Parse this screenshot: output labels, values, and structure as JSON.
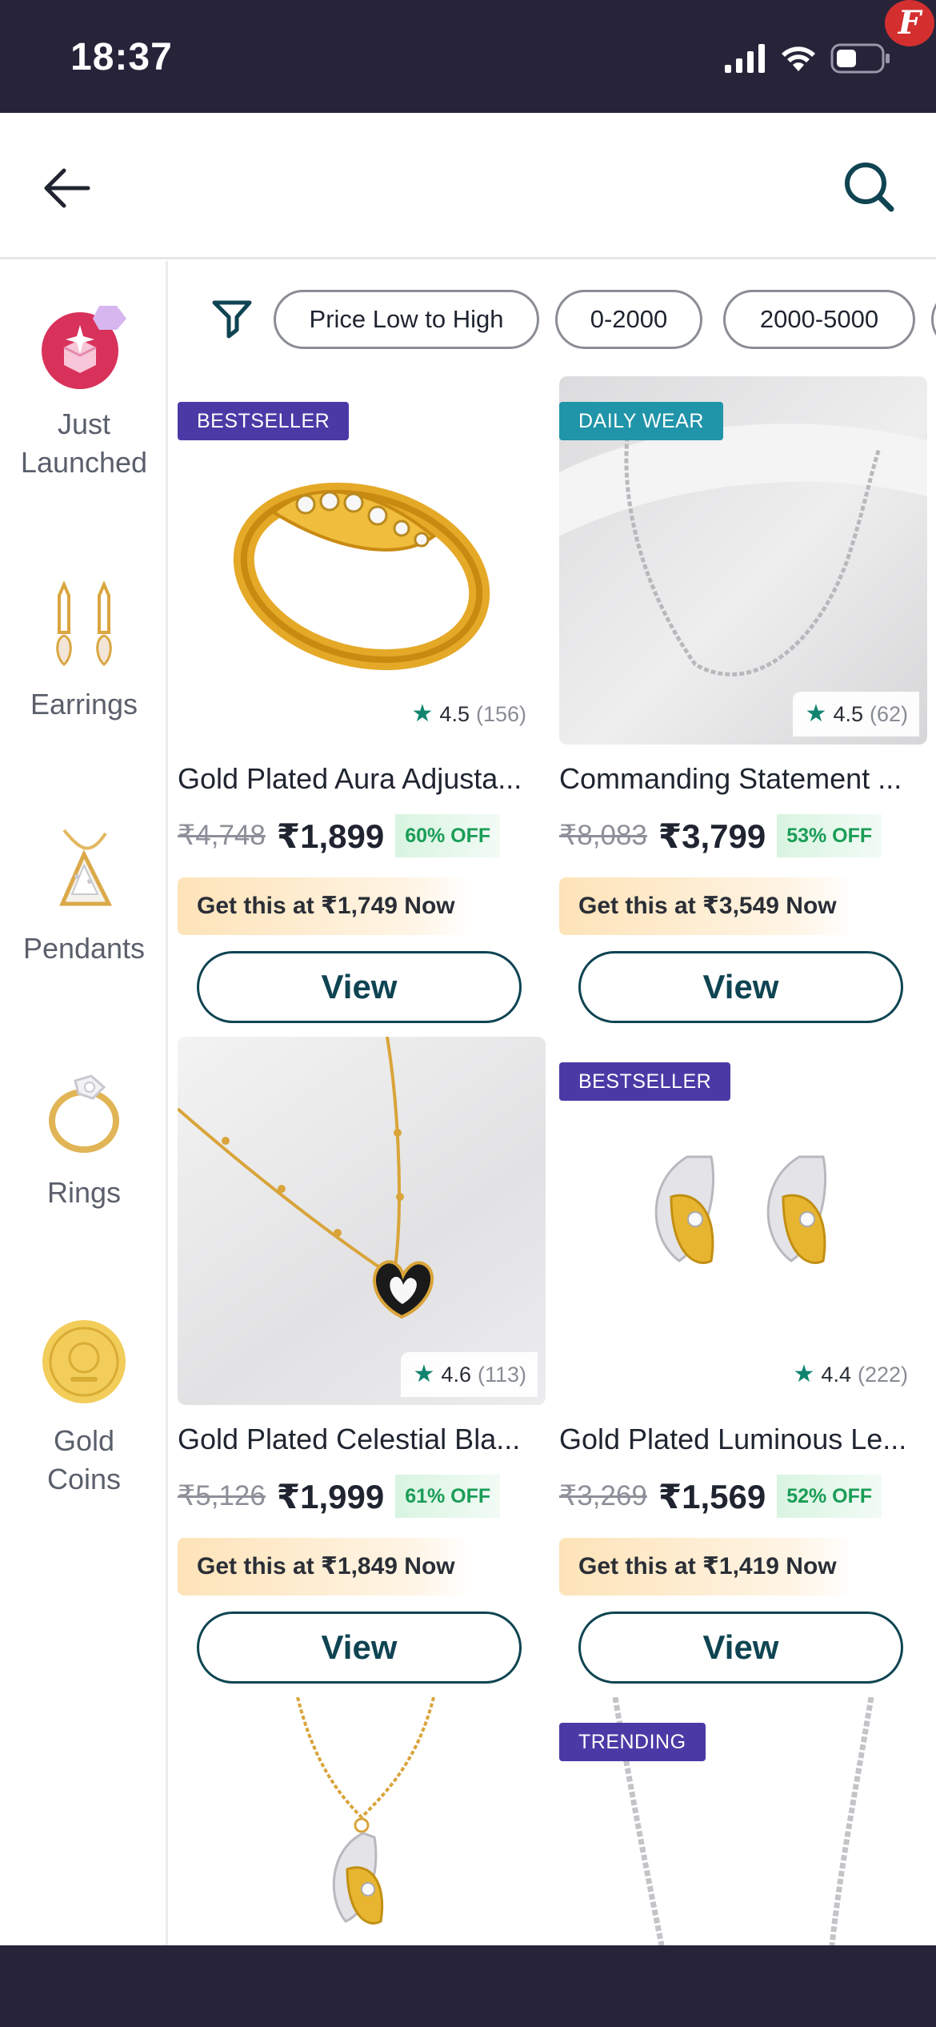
{
  "status_bar": {
    "time": "18:37",
    "app_badge": "F"
  },
  "header": {
    "back_icon": "arrow-left-icon",
    "search_icon": "search-icon"
  },
  "sidebar": {
    "items": [
      {
        "label": "Just Launched",
        "icon": "sparkle-gift-icon"
      },
      {
        "label": "Earrings",
        "icon": "earrings-icon"
      },
      {
        "label": "Pendants",
        "icon": "pendant-icon"
      },
      {
        "label": "Rings",
        "icon": "ring-icon"
      },
      {
        "label": "Gold Coins",
        "icon": "gold-coin-icon"
      }
    ]
  },
  "filters": {
    "icon": "filter-funnel-icon",
    "chips": [
      "Price Low to High",
      "0-2000",
      "2000-5000"
    ]
  },
  "products": [
    {
      "tag": "BESTSELLER",
      "rating": "4.5",
      "rating_count": "(156)",
      "title": "Gold Plated Aura Adjusta...",
      "mrp": "₹4,748",
      "price": "₹1,899",
      "discount": "60% OFF",
      "offer": "Get this at ₹1,749 Now",
      "cta": "View"
    },
    {
      "tag": "DAILY WEAR",
      "rating": "4.5",
      "rating_count": "(62)",
      "title": "Commanding Statement ...",
      "mrp": "₹8,083",
      "price": "₹3,799",
      "discount": "53% OFF",
      "offer": "Get this at ₹3,549 Now",
      "cta": "View"
    },
    {
      "tag": "",
      "rating": "4.6",
      "rating_count": "(113)",
      "title": "Gold Plated Celestial Bla...",
      "mrp": "₹5,126",
      "price": "₹1,999",
      "discount": "61% OFF",
      "offer": "Get this at ₹1,849 Now",
      "cta": "View"
    },
    {
      "tag": "BESTSELLER",
      "rating": "4.4",
      "rating_count": "(222)",
      "title": "Gold Plated Luminous Le...",
      "mrp": "₹3,269",
      "price": "₹1,569",
      "discount": "52% OFF",
      "offer": "Get this at ₹1,419 Now",
      "cta": "View"
    },
    {
      "tag": ""
    },
    {
      "tag": "TRENDING"
    }
  ],
  "colors": {
    "status_bar_bg": "#27243a",
    "tag_purple": "#4b3aa6",
    "tag_teal": "#2094a9",
    "button_teal": "#0f4452",
    "discount_green": "#1a9d57",
    "rating_star": "#10846e"
  }
}
